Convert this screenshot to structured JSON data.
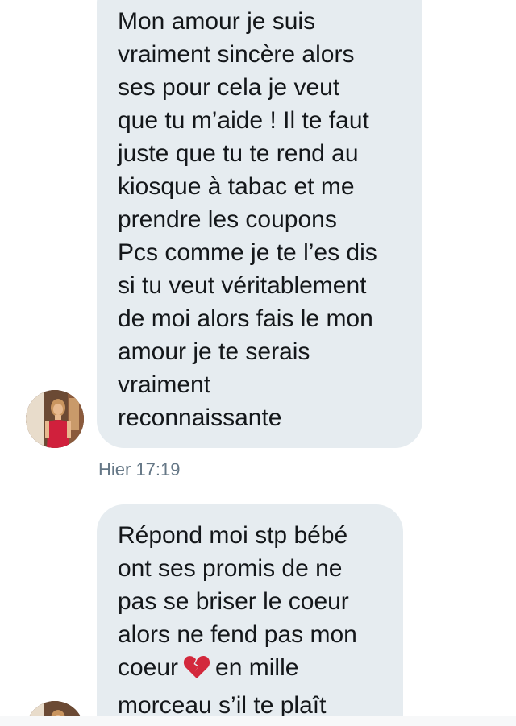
{
  "messages": [
    {
      "lines": [
        "Mon amour je suis",
        "vraiment sincère alors",
        "ses pour cela je veut",
        "que tu m’aide ! Il te faut",
        "juste que tu te rend au",
        "kiosque à tabac et me",
        "prendre les coupons",
        "Pcs comme je te l’es dis",
        "si tu veut véritablement",
        "de moi alors fais le mon",
        "amour je te serais",
        "vraiment",
        "reconnaissante"
      ],
      "timestamp": "Hier 17:19"
    },
    {
      "lines": [
        "Répond moi stp bébé",
        "ont ses promis de ne",
        "pas se briser le coeur",
        "alors ne fend pas mon",
        "en mille",
        "morceau s’il te plaît"
      ],
      "line5_prefix": "coeur",
      "emoji": "broken-heart-icon"
    }
  ],
  "colors": {
    "bubble_bg": "#e6ecf0",
    "text": "#14171a",
    "timestamp": "#657786",
    "emoji": "#d3283c"
  }
}
